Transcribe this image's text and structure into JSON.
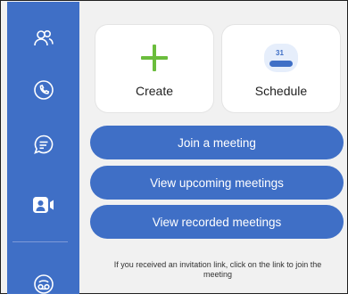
{
  "sidebar": {
    "items": [
      {
        "icon": "contacts-icon"
      },
      {
        "icon": "phone-icon"
      },
      {
        "icon": "chat-icon"
      },
      {
        "icon": "meetings-icon",
        "active": true
      },
      {
        "icon": "voicemail-icon"
      }
    ]
  },
  "tiles": {
    "create_label": "Create",
    "schedule_label": "Schedule",
    "calendar_day": "31"
  },
  "actions": {
    "join": "Join a meeting",
    "upcoming": "View upcoming meetings",
    "recorded": "View recorded meetings"
  },
  "hint": "If you received an invitation link, click on the link to join the meeting",
  "colors": {
    "accent": "#3f6fc6",
    "create_plus": "#6bbd3c",
    "background": "#f1f1f1"
  }
}
